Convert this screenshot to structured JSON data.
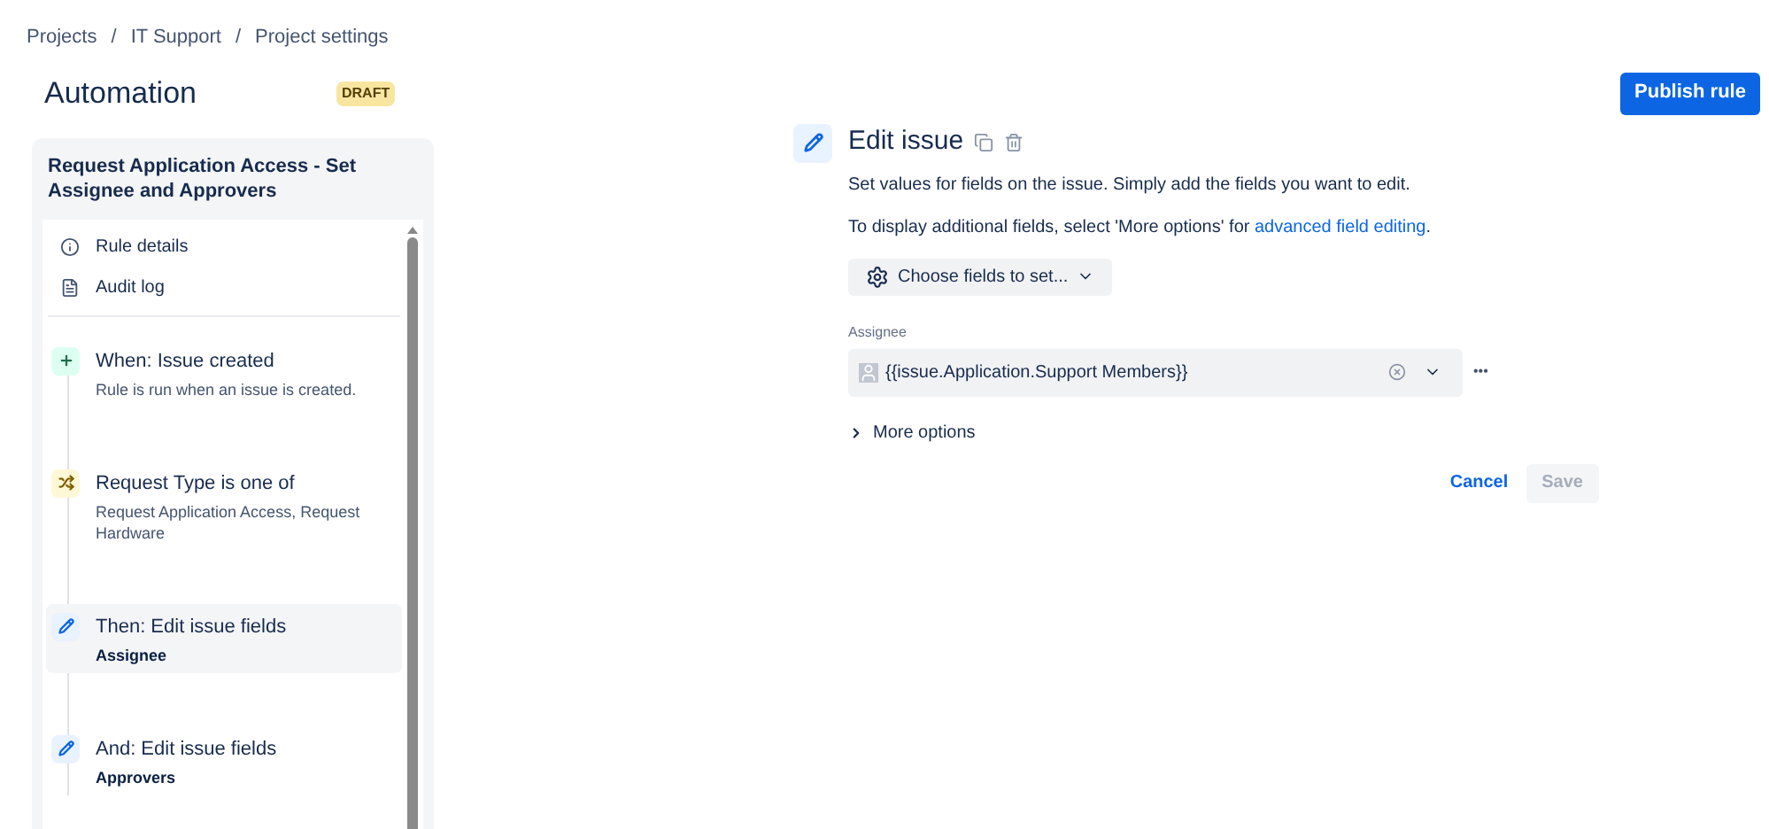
{
  "breadcrumbs": [
    "Projects",
    "IT Support",
    "Project settings"
  ],
  "breadcrumb_separator": "/",
  "page_title": "Automation",
  "status_badge": "DRAFT",
  "publish_button": "Publish rule",
  "rule": {
    "title": "Request Application Access - Set Assignee and Approvers",
    "links": [
      {
        "kind": "info",
        "label": "Rule details"
      },
      {
        "kind": "log",
        "label": "Audit log"
      }
    ],
    "steps": [
      {
        "kind": "trigger",
        "title": "When: Issue created",
        "detail": "Rule is run when an issue is created.",
        "selected": false
      },
      {
        "kind": "condition",
        "title": "Request Type is one of",
        "detail": "Request Application Access, Request Hardware",
        "selected": false
      },
      {
        "kind": "action",
        "title": "Then: Edit issue fields",
        "detail": "Assignee",
        "selected": true
      },
      {
        "kind": "action",
        "title": "And: Edit issue fields",
        "detail": "Approvers",
        "selected": false
      }
    ]
  },
  "editor": {
    "title": "Edit issue",
    "description": "Set values for fields on the issue. Simply add the fields you want to edit.",
    "hint": "To display additional fields, select 'More options' for",
    "hint_link": "advanced field editing",
    "hint_end": ".",
    "choose_button": "Choose fields to set...",
    "field": {
      "label": "Assignee",
      "value": "{{issue.Application.Support Members}}"
    },
    "more_button": "•••",
    "more_options": {
      "label": "More options",
      "expanded": false
    },
    "cancel": "Cancel",
    "save": {
      "label": "Save",
      "disabled": true
    }
  }
}
